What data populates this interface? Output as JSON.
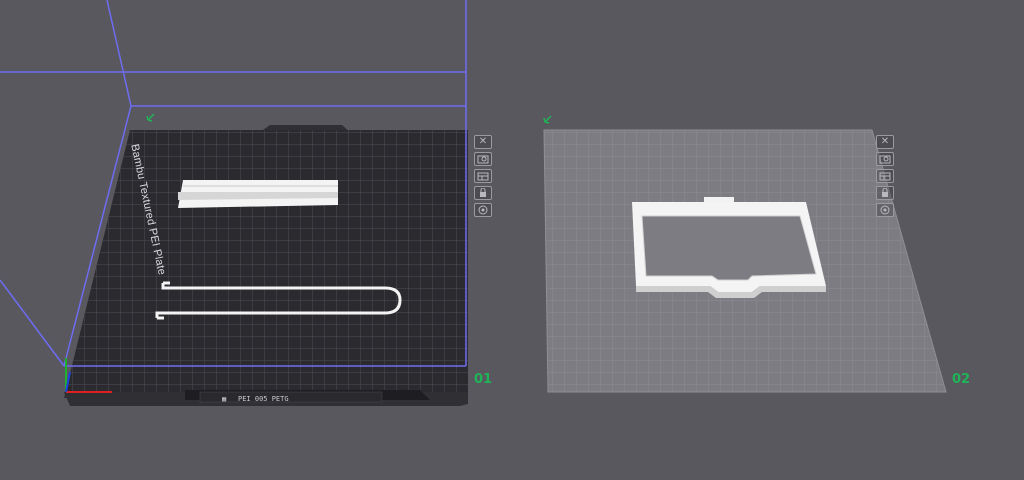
{
  "viewport": {
    "background": "#58585e",
    "build_volume_color": "#6e6cf2",
    "plates": [
      {
        "number": "01",
        "selected": true,
        "bed_texture_label": "Bambu Textured PEI Plate",
        "bed_tab_text": "PEI 005 PETG",
        "icons": [
          "close-icon",
          "auto-orient-icon",
          "arrange-icon",
          "lock-icon",
          "settings-icon"
        ]
      },
      {
        "number": "02",
        "selected": false,
        "icons": [
          "close-icon",
          "auto-orient-icon",
          "arrange-icon",
          "lock-icon",
          "settings-icon"
        ]
      }
    ],
    "label_color": "#1fb457"
  }
}
